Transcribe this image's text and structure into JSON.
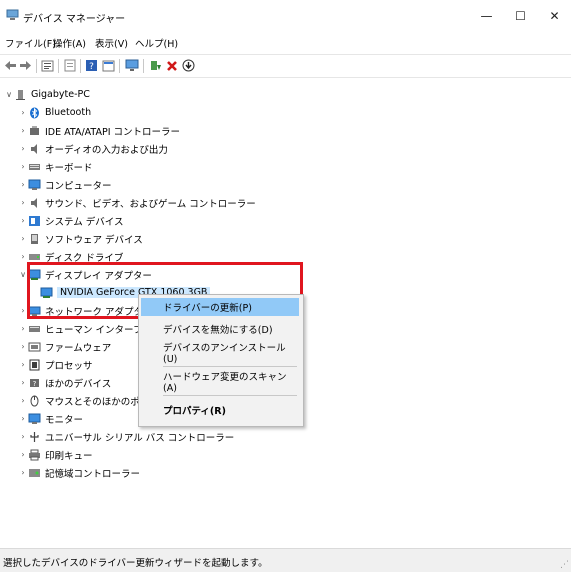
{
  "window": {
    "title": "デバイス マネージャー",
    "minimize": "—",
    "maximize": "☐",
    "close": "✕"
  },
  "menu": [
    "ファイル(F)",
    "操作(A)",
    "表示(V)",
    "ヘルプ(H)"
  ],
  "toolbar_icons": [
    "back-icon",
    "forward-icon",
    "properties-icon",
    "show-hidden-icon",
    "help-icon",
    "action-icon",
    "scan-hardware-icon",
    "update-driver-icon",
    "uninstall-icon",
    "disable-icon"
  ],
  "tree": {
    "root": "Gigabyte-PC",
    "categories": [
      {
        "label": "Bluetooth",
        "icon": "bluetooth-icon"
      },
      {
        "label": "IDE ATA/ATAPI コントローラー",
        "icon": "ide-controller-icon"
      },
      {
        "label": "オーディオの入力および出力",
        "icon": "audio-icon"
      },
      {
        "label": "キーボード",
        "icon": "keyboard-icon"
      },
      {
        "label": "コンピューター",
        "icon": "computer-icon"
      },
      {
        "label": "サウンド、ビデオ、およびゲーム コントローラー",
        "icon": "sound-icon"
      },
      {
        "label": "システム デバイス",
        "icon": "system-device-icon"
      },
      {
        "label": "ソフトウェア デバイス",
        "icon": "software-device-icon"
      },
      {
        "label": "ディスク ドライブ",
        "icon": "disk-drive-icon"
      },
      {
        "label": "ディスプレイ アダプター",
        "icon": "display-adapter-icon",
        "expanded": true
      },
      {
        "label": "ネットワーク アダプター",
        "icon": "network-adapter-icon"
      },
      {
        "label": "ヒューマン インターフェイス デ",
        "icon": "hid-icon"
      },
      {
        "label": "ファームウェア",
        "icon": "firmware-icon"
      },
      {
        "label": "プロセッサ",
        "icon": "processor-icon"
      },
      {
        "label": "ほかのデバイス",
        "icon": "other-device-icon"
      },
      {
        "label": "マウスとそのほかのポインティ",
        "icon": "mouse-icon"
      },
      {
        "label": "モニター",
        "icon": "monitor-icon"
      },
      {
        "label": "ユニバーサル シリアル バス コントローラー",
        "icon": "usb-icon"
      },
      {
        "label": "印刷キュー",
        "icon": "print-queue-icon"
      },
      {
        "label": "記憶域コントローラー",
        "icon": "storage-controller-icon"
      }
    ],
    "selected_device": "NVIDIA GeForce GTX 1060 3GB"
  },
  "context_menu": {
    "items": [
      {
        "label": "ドライバーの更新(P)",
        "highlighted": true
      },
      {
        "label": "デバイスを無効にする(D)"
      },
      {
        "label": "デバイスのアンインストール(U)"
      },
      {
        "label": "ハードウェア変更のスキャン(A)"
      },
      {
        "label": "プロパティ(R)",
        "bold": true
      }
    ]
  },
  "status": "選択したデバイスのドライバー更新ウィザードを起動します。",
  "colors": {
    "highlight_box": "#e0161f",
    "selection": "#cce8ff",
    "menu_highlight": "#91c9f7"
  }
}
